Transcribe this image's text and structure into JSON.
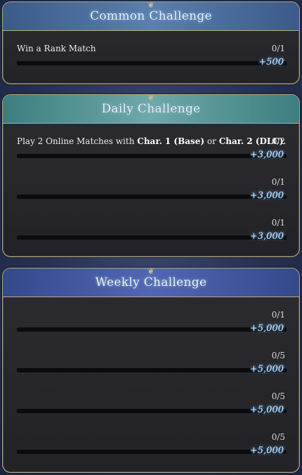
{
  "sections": [
    {
      "title": "Common Challenge",
      "ornament_icon": "crest-ornament",
      "challenges": [
        {
          "label_plain": "Win a Rank Match",
          "highlight1": "",
          "joiner": "",
          "highlight2": "",
          "end": "",
          "count": "0/1",
          "progress": 0,
          "reward": "+500"
        }
      ]
    },
    {
      "title": "Daily Challenge",
      "ornament_icon": "crest-ornament",
      "challenges": [
        {
          "label_plain": "Play 2 Online Matches with ",
          "highlight1": "Char. 1 (Base)",
          "joiner": " or ",
          "highlight2": "Char. 2 (DLC)",
          "end": ".",
          "count": "0/2",
          "progress": 0,
          "reward": "+3,000"
        },
        {
          "label_plain": "",
          "highlight1": "",
          "joiner": "",
          "highlight2": "",
          "end": "",
          "count": "0/1",
          "progress": 0,
          "reward": "+3,000"
        },
        {
          "label_plain": "",
          "highlight1": "",
          "joiner": "",
          "highlight2": "",
          "end": "",
          "count": "0/1",
          "progress": 0,
          "reward": "+3,000"
        }
      ]
    },
    {
      "title": "Weekly Challenge",
      "ornament_icon": "crest-ornament",
      "challenges": [
        {
          "label_plain": "",
          "highlight1": "",
          "joiner": "",
          "highlight2": "",
          "end": "",
          "count": "0/1",
          "progress": 0,
          "reward": "+5,000"
        },
        {
          "label_plain": "",
          "highlight1": "",
          "joiner": "",
          "highlight2": "",
          "end": "",
          "count": "0/5",
          "progress": 0,
          "reward": "+5,000"
        },
        {
          "label_plain": "",
          "highlight1": "",
          "joiner": "",
          "highlight2": "",
          "end": "",
          "count": "0/5",
          "progress": 0,
          "reward": "+5,000"
        },
        {
          "label_plain": "",
          "highlight1": "",
          "joiner": "",
          "highlight2": "",
          "end": "",
          "count": "0/5",
          "progress": 0,
          "reward": "+5,000"
        }
      ]
    }
  ],
  "colors": {
    "common_header": "#5a7fb0",
    "daily_header": "#6fa8a8",
    "weekly_header": "#5067b5",
    "frame": "#b8a98a",
    "reward_glow": "#78beff"
  }
}
